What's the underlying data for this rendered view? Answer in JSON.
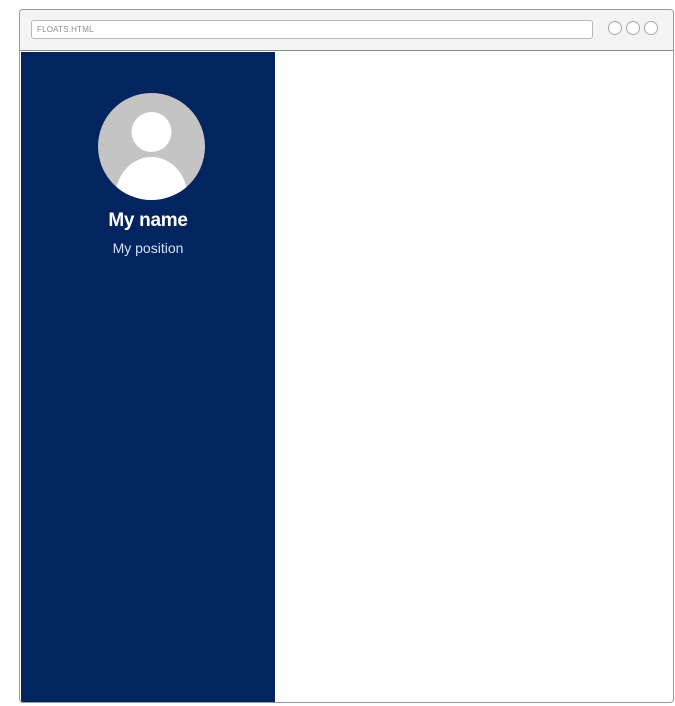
{
  "browser": {
    "address": "FLOATS.HTML",
    "controls": [
      "circle",
      "circle",
      "circle"
    ]
  },
  "sidebar": {
    "background_color": "#03255f",
    "avatar": {
      "icon": "user-silhouette-icon",
      "background_color": "#c4c4c4"
    },
    "name": "My name",
    "position": "My position"
  }
}
